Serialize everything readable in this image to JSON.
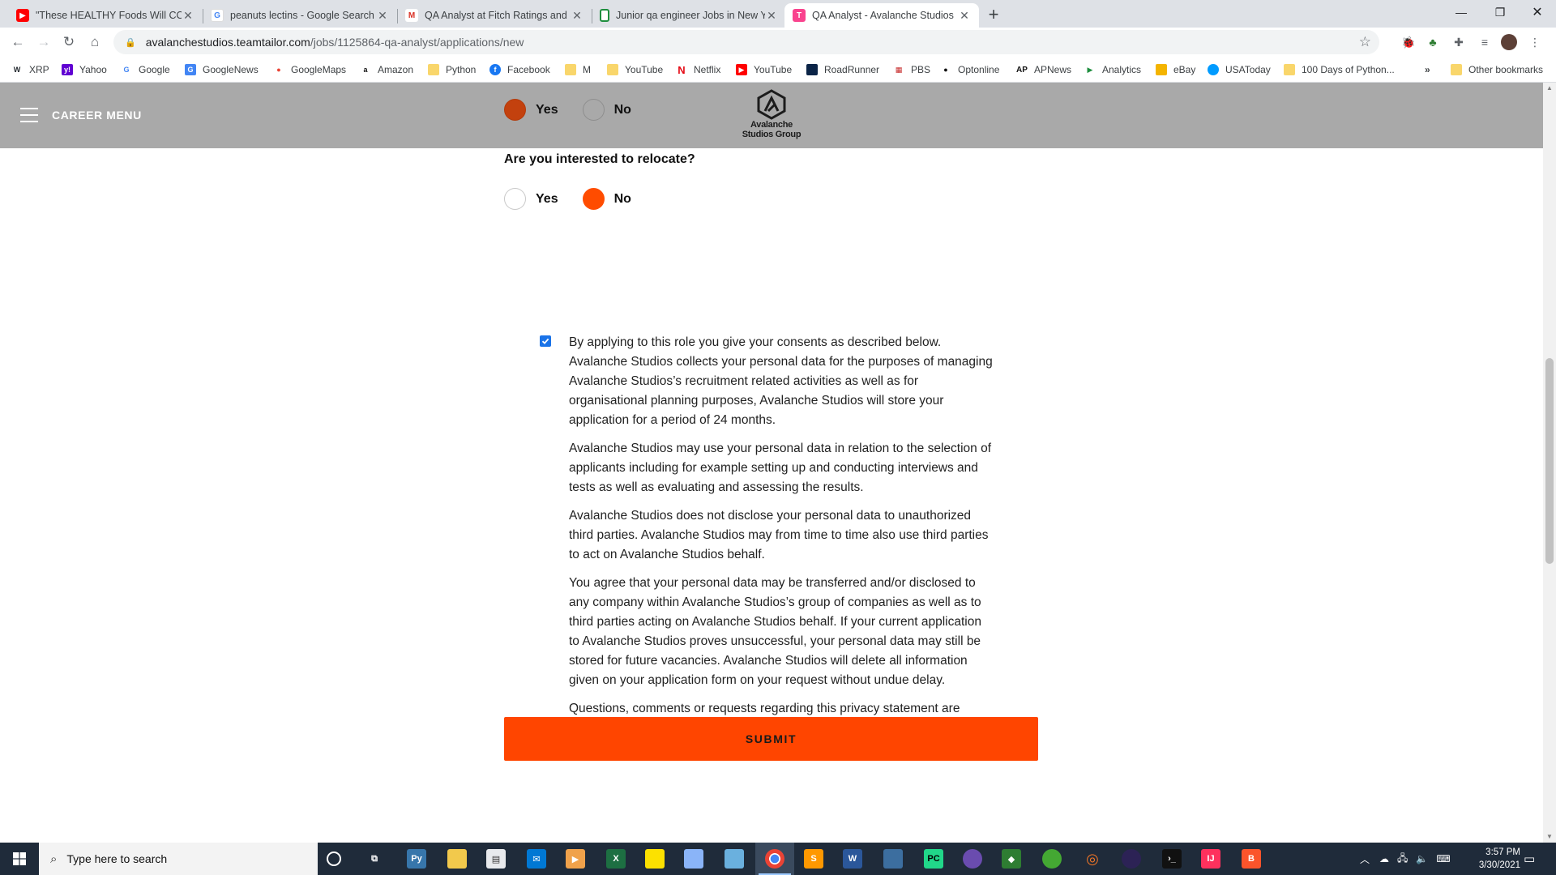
{
  "browser": {
    "tabs": [
      {
        "title": "\"These HEALTHY Foods Will COM",
        "icon": "youtube-icon",
        "color": "#ff0000"
      },
      {
        "title": "peanuts lectins - Google Search",
        "icon": "google-icon",
        "color": "#4285f4"
      },
      {
        "title": "QA Analyst at Fitch Ratings and S",
        "icon": "gmail-icon",
        "color": "#d93025"
      },
      {
        "title": "Junior qa engineer Jobs in New Y",
        "icon": "sheets-icon",
        "color": "#1e8e3e"
      },
      {
        "title": "QA Analyst - Avalanche Studios",
        "icon": "teamtailor-icon",
        "color": "#f9438e"
      }
    ],
    "address": {
      "host": "avalanchestudios.teamtailor.com",
      "path": "/jobs/1125864-qa-analyst/applications/new"
    },
    "bookmarks": [
      {
        "label": "XRP",
        "icon": "xrp-icon"
      },
      {
        "label": "Yahoo",
        "icon": "yahoo-icon"
      },
      {
        "label": "Google",
        "icon": "google-icon"
      },
      {
        "label": "GoogleNews",
        "icon": "googlenews-icon"
      },
      {
        "label": "GoogleMaps",
        "icon": "googlemaps-icon"
      },
      {
        "label": "Amazon",
        "icon": "amazon-icon"
      },
      {
        "label": "Python",
        "icon": "folder-icon"
      },
      {
        "label": "Facebook",
        "icon": "facebook-icon"
      },
      {
        "label": "M",
        "icon": "folder-icon"
      },
      {
        "label": "YouTube",
        "icon": "folder-icon"
      },
      {
        "label": "Netflix",
        "icon": "netflix-icon"
      },
      {
        "label": "YouTube",
        "icon": "youtube-icon"
      },
      {
        "label": "RoadRunner",
        "icon": "roadrunner-icon"
      },
      {
        "label": "PBS",
        "icon": "pbs-icon"
      },
      {
        "label": "Optonline",
        "icon": "optonline-icon"
      },
      {
        "label": "APNews",
        "icon": "apnews-icon"
      },
      {
        "label": "Analytics",
        "icon": "analytics-icon"
      },
      {
        "label": "eBay",
        "icon": "ebay-icon"
      },
      {
        "label": "USAToday",
        "icon": "usatoday-icon"
      },
      {
        "label": "100 Days of Python...",
        "icon": "folder-icon"
      }
    ],
    "more_bookmarks": "»",
    "other_bookmarks": "Other bookmarks"
  },
  "site": {
    "menu_label": "CAREER MENU",
    "logo_line1": "Avalanche",
    "logo_line2": "Studios Group"
  },
  "form": {
    "prev_question": {
      "options": [
        {
          "label": "Yes",
          "selected": true
        },
        {
          "label": "No",
          "selected": false
        }
      ]
    },
    "relocate": {
      "question": "Are you interested to relocate?",
      "options": [
        {
          "label": "Yes",
          "selected": false
        },
        {
          "label": "No",
          "selected": true
        }
      ]
    },
    "consent": {
      "checked": true,
      "paragraphs": [
        "By applying to this role you give your consents as described below. Avalanche Studios collects your personal data for the purposes of managing Avalanche Studios’s recruitment related activities as well as for organisational planning purposes, Avalanche Studios will store your application for a period of 24 months.",
        "Avalanche Studios may use your personal data in relation to the selection of applicants including for example setting up and conducting interviews and tests as well as evaluating and assessing the results.",
        "Avalanche Studios does not disclose your personal data to unauthorized third parties. Avalanche Studios may from time to time also use third parties to act on Avalanche Studios behalf.",
        "You agree that your personal data may be transferred and/or disclosed to any company within Avalanche Studios’s group of companies as well as to third parties acting on Avalanche Studios behalf. If your current application to Avalanche Studios proves unsuccessful, your personal data may still be stored for future vacancies. Avalanche Studios will delete all information given on your application form on your request without undue delay.",
        "Questions, comments or requests regarding this privacy statement are welcome and should be addressed to: info@avalanchestudios.se"
      ]
    },
    "submit_label": "SUBMIT",
    "accent_color": "#ff4500"
  },
  "taskbar": {
    "search_placeholder": "Type here to search",
    "time": "3:57 PM",
    "date": "3/30/2021",
    "apps": [
      "cortana-icon",
      "task-view-icon",
      "python-icon",
      "file-explorer-icon",
      "store-icon",
      "mail-icon",
      "media-player-icon",
      "excel-icon",
      "sticky-notes-icon",
      "paint-icon",
      "folder-icon",
      "chrome-icon",
      "sublime-icon",
      "word-icon",
      "visual-studio-icon",
      "pycharm-icon",
      "app-icon",
      "kite-icon",
      "anaconda-icon",
      "jupyter-icon",
      "eclipse-icon",
      "terminal-icon",
      "intellij-icon",
      "brave-icon"
    ]
  }
}
